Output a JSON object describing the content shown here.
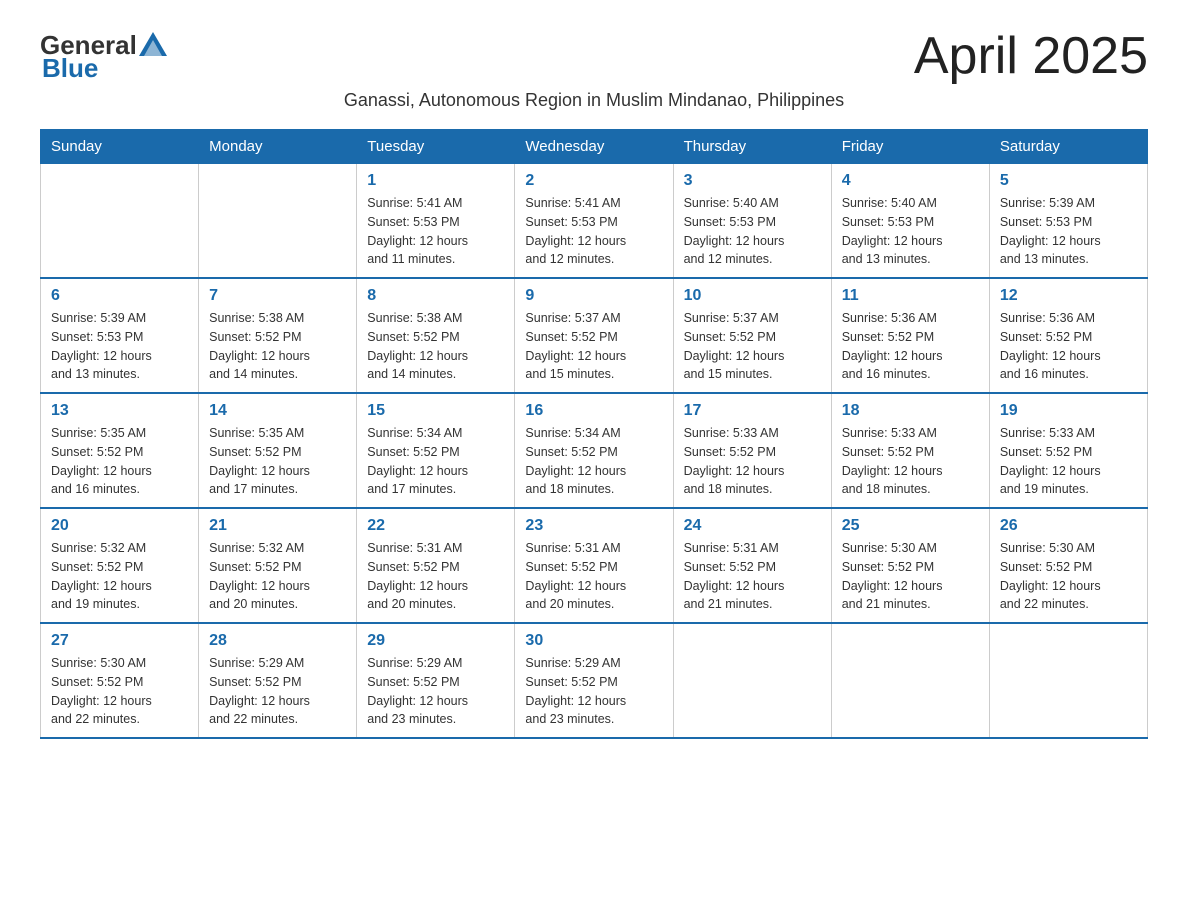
{
  "header": {
    "logo_general": "General",
    "logo_blue": "Blue",
    "month_title": "April 2025",
    "subtitle": "Ganassi, Autonomous Region in Muslim Mindanao, Philippines"
  },
  "days_of_week": [
    "Sunday",
    "Monday",
    "Tuesday",
    "Wednesday",
    "Thursday",
    "Friday",
    "Saturday"
  ],
  "weeks": [
    [
      {
        "day": "",
        "info": ""
      },
      {
        "day": "",
        "info": ""
      },
      {
        "day": "1",
        "info": "Sunrise: 5:41 AM\nSunset: 5:53 PM\nDaylight: 12 hours\nand 11 minutes."
      },
      {
        "day": "2",
        "info": "Sunrise: 5:41 AM\nSunset: 5:53 PM\nDaylight: 12 hours\nand 12 minutes."
      },
      {
        "day": "3",
        "info": "Sunrise: 5:40 AM\nSunset: 5:53 PM\nDaylight: 12 hours\nand 12 minutes."
      },
      {
        "day": "4",
        "info": "Sunrise: 5:40 AM\nSunset: 5:53 PM\nDaylight: 12 hours\nand 13 minutes."
      },
      {
        "day": "5",
        "info": "Sunrise: 5:39 AM\nSunset: 5:53 PM\nDaylight: 12 hours\nand 13 minutes."
      }
    ],
    [
      {
        "day": "6",
        "info": "Sunrise: 5:39 AM\nSunset: 5:53 PM\nDaylight: 12 hours\nand 13 minutes."
      },
      {
        "day": "7",
        "info": "Sunrise: 5:38 AM\nSunset: 5:52 PM\nDaylight: 12 hours\nand 14 minutes."
      },
      {
        "day": "8",
        "info": "Sunrise: 5:38 AM\nSunset: 5:52 PM\nDaylight: 12 hours\nand 14 minutes."
      },
      {
        "day": "9",
        "info": "Sunrise: 5:37 AM\nSunset: 5:52 PM\nDaylight: 12 hours\nand 15 minutes."
      },
      {
        "day": "10",
        "info": "Sunrise: 5:37 AM\nSunset: 5:52 PM\nDaylight: 12 hours\nand 15 minutes."
      },
      {
        "day": "11",
        "info": "Sunrise: 5:36 AM\nSunset: 5:52 PM\nDaylight: 12 hours\nand 16 minutes."
      },
      {
        "day": "12",
        "info": "Sunrise: 5:36 AM\nSunset: 5:52 PM\nDaylight: 12 hours\nand 16 minutes."
      }
    ],
    [
      {
        "day": "13",
        "info": "Sunrise: 5:35 AM\nSunset: 5:52 PM\nDaylight: 12 hours\nand 16 minutes."
      },
      {
        "day": "14",
        "info": "Sunrise: 5:35 AM\nSunset: 5:52 PM\nDaylight: 12 hours\nand 17 minutes."
      },
      {
        "day": "15",
        "info": "Sunrise: 5:34 AM\nSunset: 5:52 PM\nDaylight: 12 hours\nand 17 minutes."
      },
      {
        "day": "16",
        "info": "Sunrise: 5:34 AM\nSunset: 5:52 PM\nDaylight: 12 hours\nand 18 minutes."
      },
      {
        "day": "17",
        "info": "Sunrise: 5:33 AM\nSunset: 5:52 PM\nDaylight: 12 hours\nand 18 minutes."
      },
      {
        "day": "18",
        "info": "Sunrise: 5:33 AM\nSunset: 5:52 PM\nDaylight: 12 hours\nand 18 minutes."
      },
      {
        "day": "19",
        "info": "Sunrise: 5:33 AM\nSunset: 5:52 PM\nDaylight: 12 hours\nand 19 minutes."
      }
    ],
    [
      {
        "day": "20",
        "info": "Sunrise: 5:32 AM\nSunset: 5:52 PM\nDaylight: 12 hours\nand 19 minutes."
      },
      {
        "day": "21",
        "info": "Sunrise: 5:32 AM\nSunset: 5:52 PM\nDaylight: 12 hours\nand 20 minutes."
      },
      {
        "day": "22",
        "info": "Sunrise: 5:31 AM\nSunset: 5:52 PM\nDaylight: 12 hours\nand 20 minutes."
      },
      {
        "day": "23",
        "info": "Sunrise: 5:31 AM\nSunset: 5:52 PM\nDaylight: 12 hours\nand 20 minutes."
      },
      {
        "day": "24",
        "info": "Sunrise: 5:31 AM\nSunset: 5:52 PM\nDaylight: 12 hours\nand 21 minutes."
      },
      {
        "day": "25",
        "info": "Sunrise: 5:30 AM\nSunset: 5:52 PM\nDaylight: 12 hours\nand 21 minutes."
      },
      {
        "day": "26",
        "info": "Sunrise: 5:30 AM\nSunset: 5:52 PM\nDaylight: 12 hours\nand 22 minutes."
      }
    ],
    [
      {
        "day": "27",
        "info": "Sunrise: 5:30 AM\nSunset: 5:52 PM\nDaylight: 12 hours\nand 22 minutes."
      },
      {
        "day": "28",
        "info": "Sunrise: 5:29 AM\nSunset: 5:52 PM\nDaylight: 12 hours\nand 22 minutes."
      },
      {
        "day": "29",
        "info": "Sunrise: 5:29 AM\nSunset: 5:52 PM\nDaylight: 12 hours\nand 23 minutes."
      },
      {
        "day": "30",
        "info": "Sunrise: 5:29 AM\nSunset: 5:52 PM\nDaylight: 12 hours\nand 23 minutes."
      },
      {
        "day": "",
        "info": ""
      },
      {
        "day": "",
        "info": ""
      },
      {
        "day": "",
        "info": ""
      }
    ]
  ]
}
